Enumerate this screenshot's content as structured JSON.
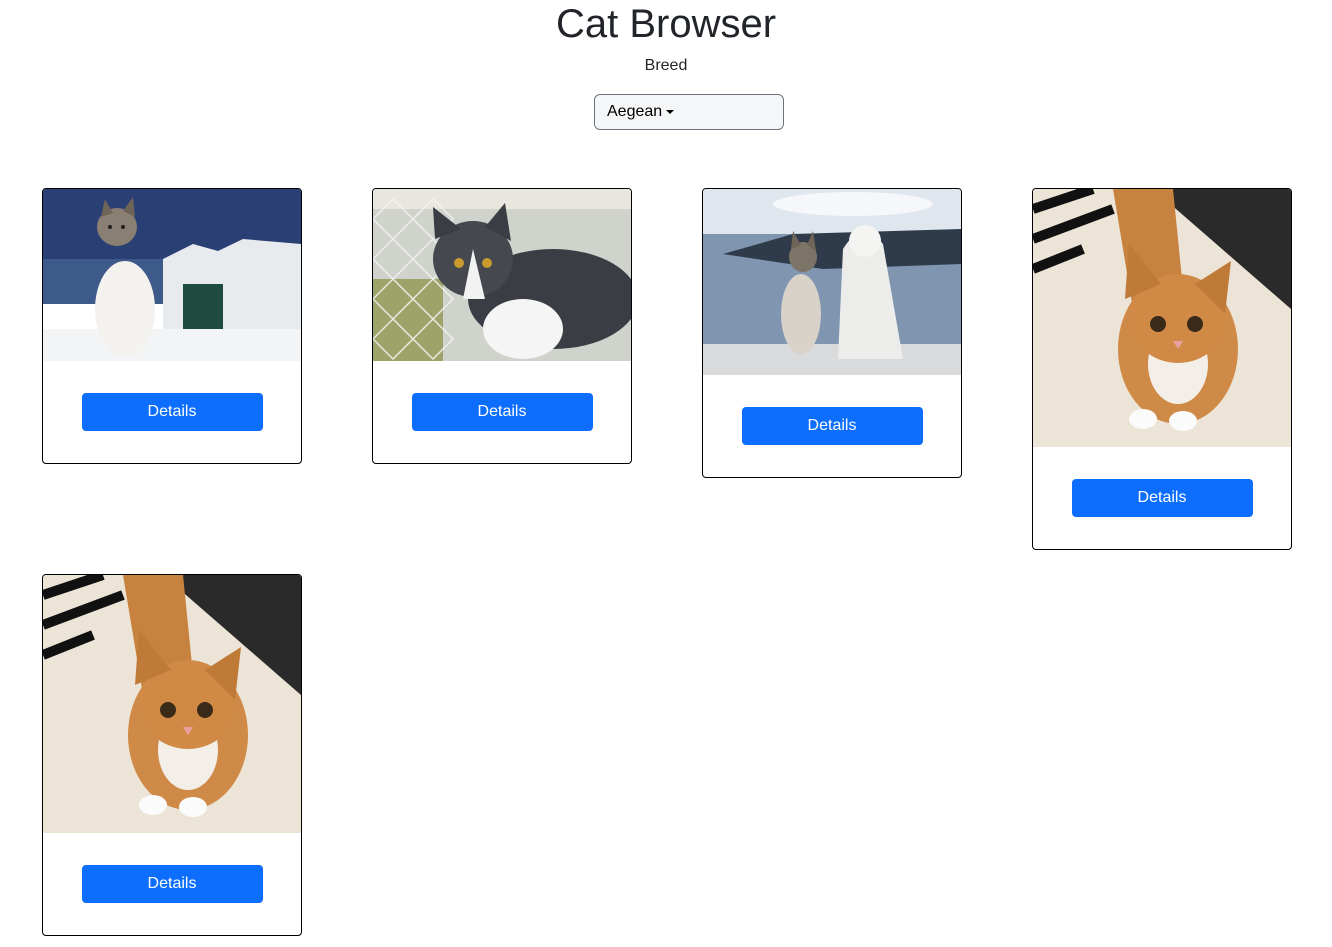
{
  "header": {
    "title": "Cat Browser"
  },
  "filter": {
    "label": "Breed",
    "selected": "Aegean"
  },
  "cats": [
    {
      "image": "cat-on-santorini-terrace",
      "button_label": "Details"
    },
    {
      "image": "cat-by-wire-fence",
      "button_label": "Details"
    },
    {
      "image": "cat-beside-lion-statue",
      "button_label": "Details"
    },
    {
      "image": "orange-tabby-on-bed",
      "button_label": "Details"
    },
    {
      "image": "orange-tabby-on-bed",
      "button_label": "Details"
    }
  ]
}
